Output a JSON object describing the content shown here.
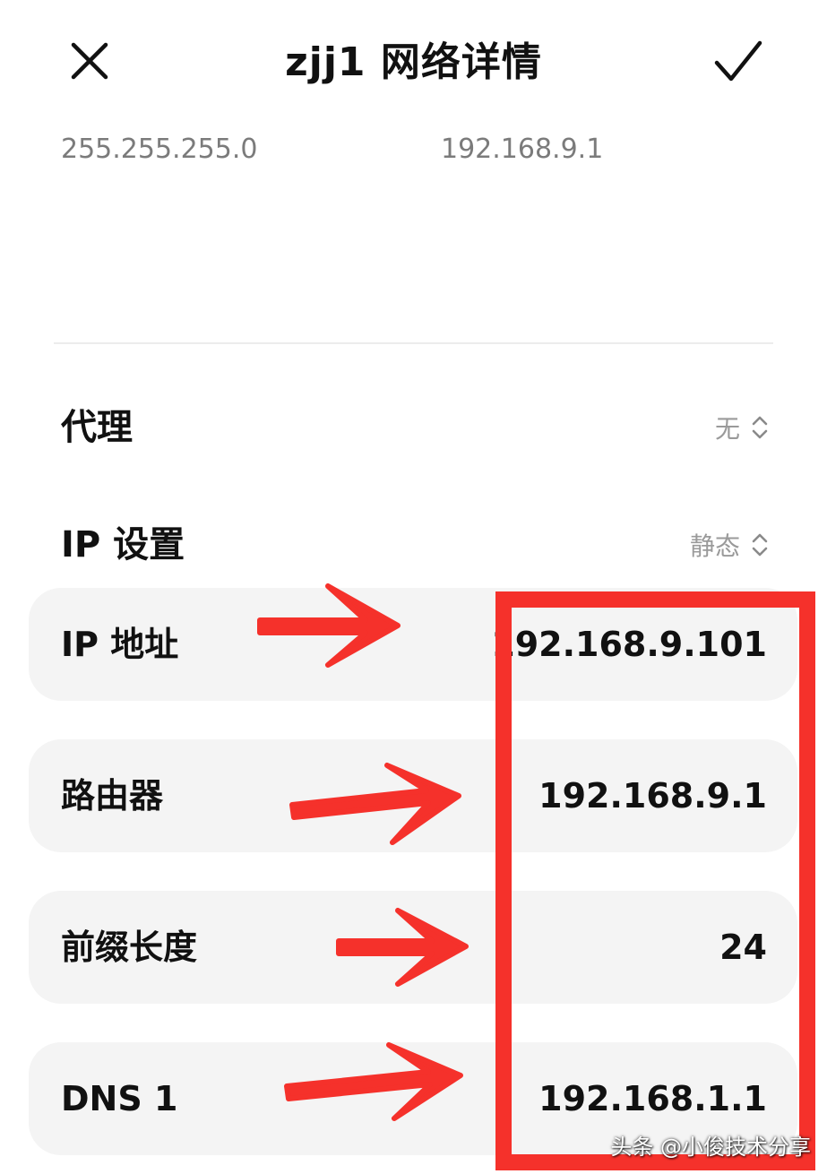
{
  "header": {
    "title": "zjj1 网络详情",
    "close_icon": "close-icon",
    "confirm_icon": "check-icon"
  },
  "previous": {
    "left_value": "255.255.255.0",
    "right_value": "192.168.9.1"
  },
  "settings": {
    "proxy": {
      "label": "代理",
      "value": "无",
      "icon": "updown-chevron-icon"
    },
    "ip_settings": {
      "label": "IP 设置",
      "value": "静态",
      "icon": "updown-chevron-icon"
    }
  },
  "fields": [
    {
      "label": "IP 地址",
      "value": "192.168.9.101"
    },
    {
      "label": "路由器",
      "value": "192.168.9.1"
    },
    {
      "label": "前缀长度",
      "value": "24"
    },
    {
      "label": "DNS 1",
      "value": "192.168.1.1"
    }
  ],
  "annotation": {
    "color": "#f5312b"
  },
  "watermark": "头条 @小俊技术分享"
}
